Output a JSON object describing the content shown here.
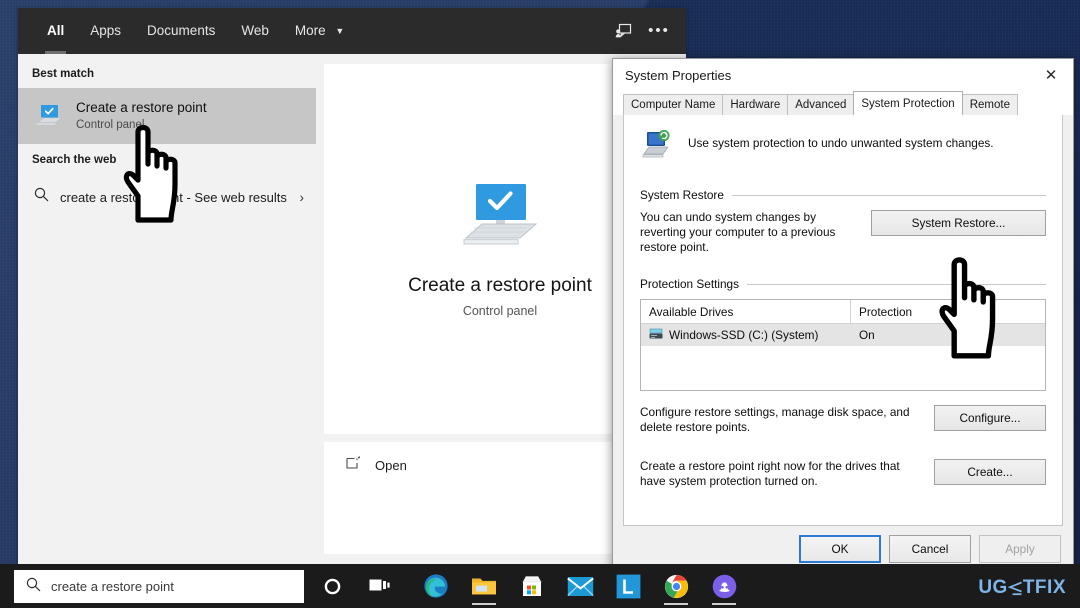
{
  "search_flyout": {
    "tabs": [
      {
        "label": "All",
        "active": true
      },
      {
        "label": "Apps",
        "active": false
      },
      {
        "label": "Documents",
        "active": false
      },
      {
        "label": "Web",
        "active": false
      },
      {
        "label": "More",
        "active": false,
        "caret": "▼"
      }
    ],
    "header_icons": {
      "feedback": "feedback-icon",
      "more": "•••"
    },
    "best_match_label": "Best match",
    "best_match": {
      "title": "Create a restore point",
      "subtitle": "Control panel",
      "icon": "restore-point-icon"
    },
    "search_web_label": "Search the web",
    "web_suggestion": {
      "text": "create a restore point - See web results",
      "icon": "search-icon",
      "chevron": "›"
    },
    "preview": {
      "title": "Create a restore point",
      "subtitle": "Control panel",
      "icon": "restore-point-icon",
      "action_label": "Open",
      "action_icon": "open-external-icon"
    }
  },
  "system_properties": {
    "title": "System Properties",
    "close_glyph": "✕",
    "tabs": [
      {
        "label": "Computer Name",
        "active": false
      },
      {
        "label": "Hardware",
        "active": false
      },
      {
        "label": "Advanced",
        "active": false
      },
      {
        "label": "System Protection",
        "active": true
      },
      {
        "label": "Remote",
        "active": false
      }
    ],
    "intro_text": "Use system protection to undo unwanted system changes.",
    "intro_icon": "system-protection-icon",
    "system_restore": {
      "group_label": "System Restore",
      "description": "You can undo system changes by reverting your computer to a previous restore point.",
      "button_label": "System Restore..."
    },
    "protection_settings": {
      "group_label": "Protection Settings",
      "columns": [
        "Available Drives",
        "Protection"
      ],
      "rows": [
        {
          "drive": "Windows-SSD (C:) (System)",
          "protection": "On",
          "icon": "hard-drive-icon"
        }
      ],
      "configure_description": "Configure restore settings, manage disk space, and delete restore points.",
      "configure_button": "Configure...",
      "create_description": "Create a restore point right now for the drives that have system protection turned on.",
      "create_button": "Create..."
    },
    "footer": {
      "ok": "OK",
      "cancel": "Cancel",
      "apply": "Apply"
    }
  },
  "taskbar": {
    "search_value": "create a restore point",
    "search_icon": "search-icon",
    "cortana_icon": "cortana-circle-icon",
    "task_view_icon": "task-view-icon",
    "apps": [
      {
        "name": "edge-icon",
        "running": false
      },
      {
        "name": "file-explorer-icon",
        "running": true
      },
      {
        "name": "microsoft-store-icon",
        "running": false
      },
      {
        "name": "mail-icon",
        "running": false
      },
      {
        "name": "app-l-icon",
        "running": false
      },
      {
        "name": "chrome-icon",
        "running": true
      },
      {
        "name": "discord-icon",
        "running": true
      }
    ]
  },
  "watermark": {
    "part1": "UG",
    "part2": "TFIX"
  },
  "colors": {
    "accent": "#0078d7",
    "desktop": "#1d3561",
    "taskbar": "#1b1b1b",
    "flyout_bg": "#f2f2f2",
    "selection": "#c6c6c6",
    "watermark": "#7fb4e8"
  }
}
